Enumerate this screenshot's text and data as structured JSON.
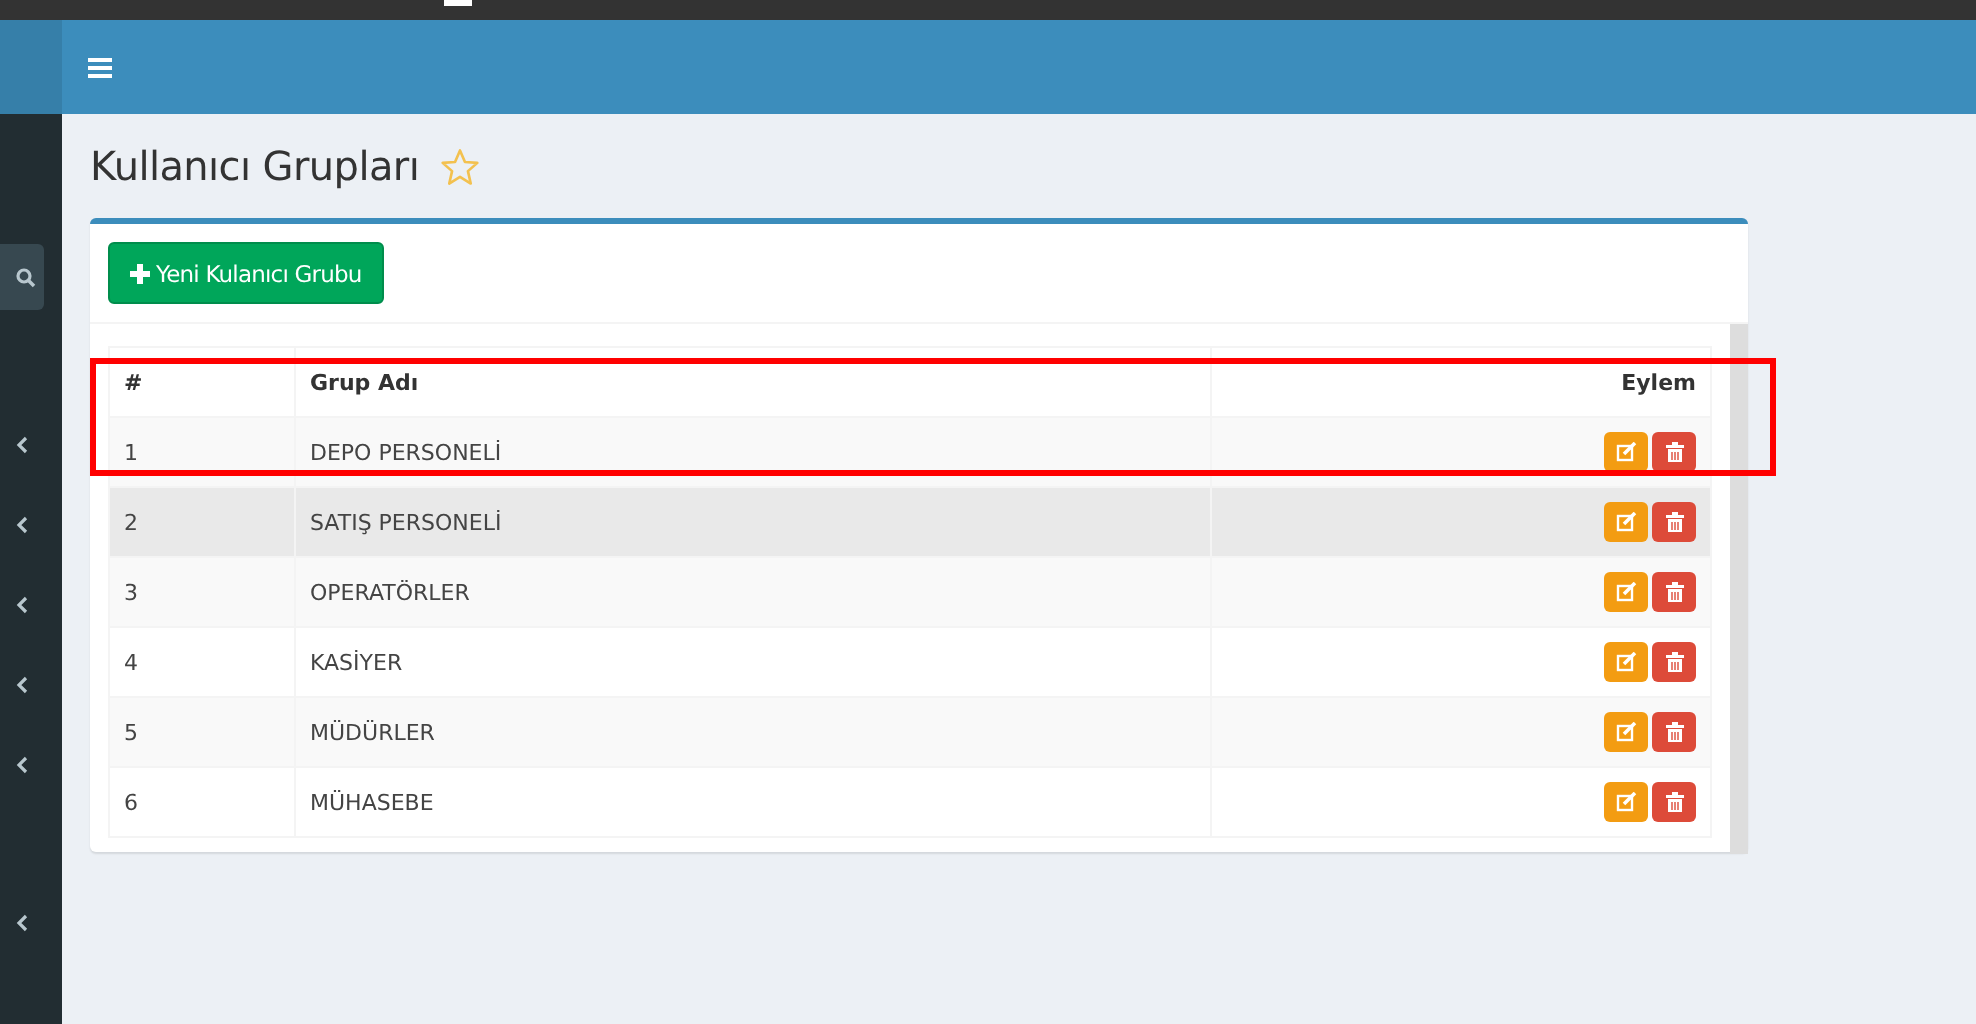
{
  "page": {
    "title": "Kullanıcı Grupları",
    "favorite": false
  },
  "toolbar": {
    "add_button": "Yeni Kulanıcı Grubu"
  },
  "table": {
    "columns": [
      "#",
      "Grup Adı",
      "Eylem"
    ],
    "rows": [
      {
        "no": "1",
        "name": "DEPO PERSONELİ",
        "hovered": false
      },
      {
        "no": "2",
        "name": "SATIŞ PERSONELİ",
        "hovered": true
      },
      {
        "no": "3",
        "name": "OPERATÖRLER",
        "hovered": false
      },
      {
        "no": "4",
        "name": "KASİYER",
        "hovered": false
      },
      {
        "no": "5",
        "name": "MÜDÜRLER",
        "hovered": false
      },
      {
        "no": "6",
        "name": "MÜHASEBE",
        "hovered": false
      }
    ]
  },
  "annotations": [
    {
      "kind": "frame"
    }
  ]
}
